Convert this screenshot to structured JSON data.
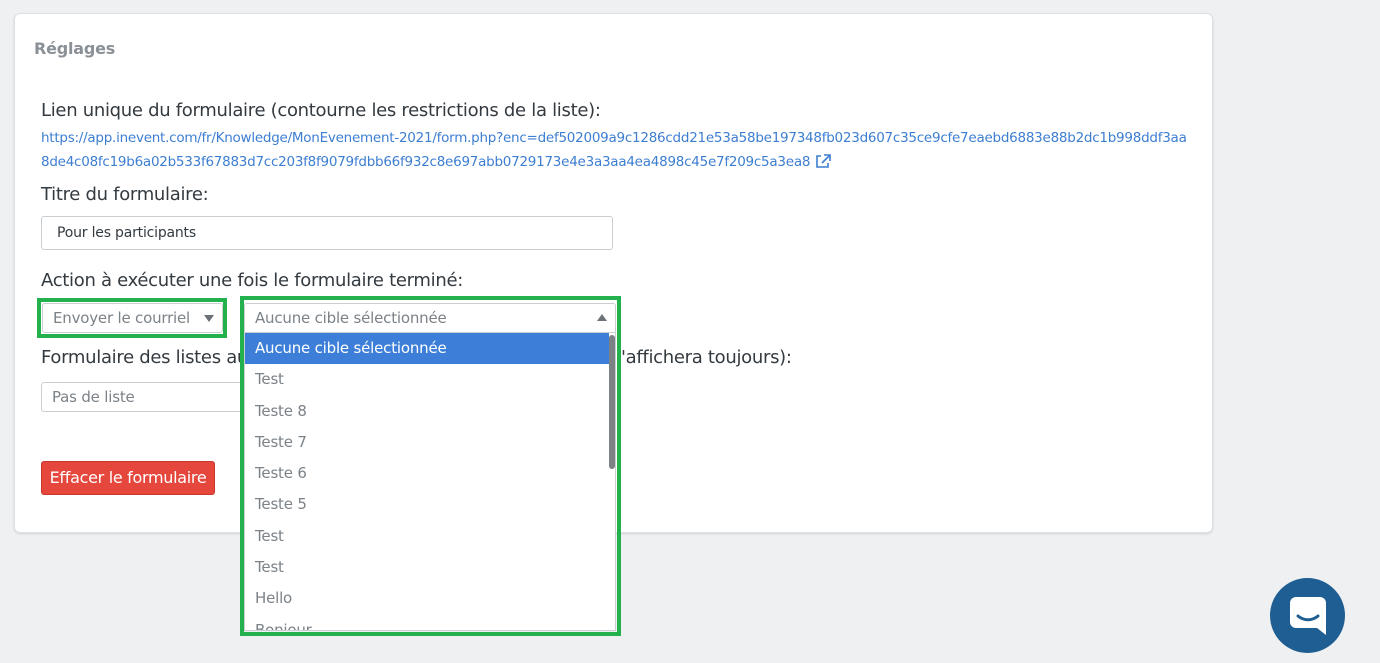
{
  "card": {
    "title": "Réglages"
  },
  "form": {
    "unique_link_label": "Lien unique du formulaire (contourne les restrictions de la liste):",
    "unique_link_url": "https://app.inevent.com/fr/Knowledge/MonEvenement-2021/form.php?enc=def502009a9c1286cdd21e53a58be197348fb023d607c35ce9cfe7eaebd6883e88b2dc1b998ddf3aa8de4c08fc19b6a02b533f67883d7cc203f8f9079fdbb66f932c8e697abb0729173e4e3a3aa4ea4898c45e7f209c5a3ea8",
    "title_label": "Titre du formulaire:",
    "title_value": "Pour les participants",
    "action_label": "Action à exécuter une fois le formulaire terminé:",
    "action_select_value": "Envoyer le courriel",
    "target_select_value": "Aucune cible sélectionnée",
    "lists_label_left": "Formulaire des listes aut",
    "lists_label_right": "'affichera toujours):",
    "lists_select_value": "Pas de liste",
    "delete_button": "Effacer le formulaire"
  },
  "target_dropdown": {
    "options": [
      "Aucune cible sélectionnée",
      "Test",
      "Teste 8",
      "Teste 7",
      "Teste 6",
      "Teste 5",
      "Test",
      "Test",
      "Hello",
      "Bonjour"
    ],
    "selected_index": 0
  },
  "colors": {
    "highlight": "#22b14c",
    "link": "#3d7ed1",
    "selected_option": "#3d7fd8",
    "danger": "#e5473c",
    "chat": "#1f5e93"
  },
  "icons": {
    "external_link": "external-link-icon",
    "dropdown_arrow": "caret-down-icon",
    "chat": "chat-icon"
  }
}
